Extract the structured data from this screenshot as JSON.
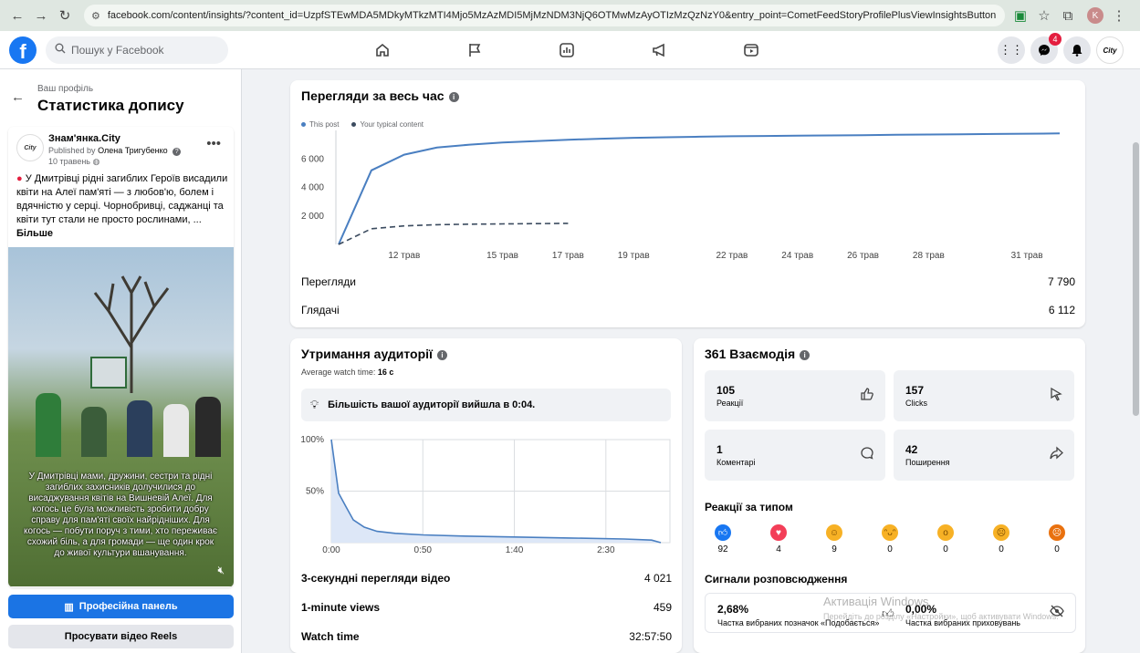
{
  "browser": {
    "url": "facebook.com/content/insights/?content_id=UzpfSTEwMDA5MDkyMTkzMTI4Mjo5MzAzMDI5MjMzNDM3NjQ6OTMwMzAyOTIzMzQzNzY0&entry_point=CometFeedStoryProfilePlusViewInsightsButton",
    "profile_initial": "K"
  },
  "fb": {
    "search_placeholder": "Пошук у Facebook",
    "messenger_badge": "4",
    "page_logo_text": "City"
  },
  "left": {
    "subtitle": "Ваш профіль",
    "title": "Статистика допису",
    "post": {
      "page_name": "Знам'янка.City",
      "published_prefix": "Published by",
      "author": "Олена Тригубенко",
      "date": "10 травень",
      "text": "У Дмитрівці рідні загиблих Героїв висадили квіти на Алеї пам'яті — з любов'ю, болем і вдячністю у серці. Чорнобривці, саджанці та квіти тут стали не просто рослинами, ...",
      "more": "Більше",
      "video_caption": "У Дмитрівці мами, дружини, сестри та рідні загиблих захисників долучилися до висаджування квітів на Вишневій Алеї. Для когось це була можливість зробити добру справу для пам'яті своїх найрідніших. Для когось — побути поруч з тими, хто переживає схожий біль, а для громади — ще один крок до живої культури вшанування.",
      "logo_text": "City"
    },
    "btn_pro": "Професійна панель",
    "btn_reels": "Просувати відео Reels"
  },
  "views": {
    "title": "Перегляди за весь час",
    "legend_this": "This post",
    "legend_typical": "Your typical content",
    "views_label": "Перегляди",
    "views_value": "7 790",
    "viewers_label": "Глядачі",
    "viewers_value": "6 112",
    "colors": {
      "this_post": "#4a7fc1",
      "typical": "#3b4b5f"
    }
  },
  "chart_data": [
    {
      "type": "line",
      "title": "Перегляди за весь час",
      "x": [
        "10 трав",
        "11 трав",
        "12 трав",
        "13 трав",
        "14 трав",
        "15 трав",
        "16 трав",
        "17 трав",
        "18 трав",
        "19 трав",
        "20 трав",
        "21 трав",
        "22 трав",
        "23 трав",
        "24 трав",
        "25 трав",
        "26 трав",
        "27 трав",
        "28 трав",
        "29 трав",
        "30 трав",
        "31 трав",
        "1 черв"
      ],
      "x_tick_labels": [
        "12 трав",
        "15 трав",
        "17 трав",
        "19 трав",
        "22 трав",
        "24 трав",
        "26 трав",
        "28 трав",
        "31 трав"
      ],
      "y_tick_labels": [
        "2 000",
        "4 000",
        "6 000"
      ],
      "ylim": [
        0,
        8000
      ],
      "series": [
        {
          "name": "This post",
          "values": [
            0,
            5200,
            6300,
            6800,
            7000,
            7150,
            7250,
            7350,
            7420,
            7480,
            7520,
            7560,
            7590,
            7610,
            7630,
            7650,
            7670,
            7690,
            7710,
            7730,
            7750,
            7770,
            7790
          ]
        },
        {
          "name": "Your typical content",
          "values": [
            0,
            1100,
            1300,
            1380,
            1420,
            1440,
            1460,
            1480
          ]
        }
      ]
    },
    {
      "type": "area",
      "title": "Утримання аудиторії",
      "x_tick_labels": [
        "0:00",
        "0:50",
        "1:40",
        "2:30"
      ],
      "y_tick_labels": [
        "100%",
        "50%"
      ],
      "xlim_seconds": [
        0,
        185
      ],
      "ylim": [
        0,
        100
      ],
      "x_seconds": [
        0,
        4,
        8,
        12,
        18,
        25,
        35,
        50,
        70,
        100,
        130,
        160,
        175,
        180
      ],
      "values": [
        100,
        48,
        35,
        22,
        15,
        11,
        9,
        7.5,
        6.5,
        5.5,
        4.5,
        3.5,
        2.5,
        0
      ]
    }
  ],
  "retention": {
    "title": "Утримання аудиторії",
    "avg_label": "Average watch time:",
    "avg_value": "16 с",
    "note": "Більшість вашої аудиторії вийшла в 0:04.",
    "rows": [
      {
        "label": "3-секундні перегляди відео",
        "value": "4 021"
      },
      {
        "label": "1-minute views",
        "value": "459"
      },
      {
        "label": "Watch time",
        "value": "32:57:50"
      }
    ]
  },
  "interactions": {
    "title": "361 Взаємодія",
    "metrics": [
      {
        "value": "105",
        "label": "Реакції",
        "icon": "like-icon"
      },
      {
        "value": "157",
        "label": "Clicks",
        "icon": "cursor-icon"
      },
      {
        "value": "1",
        "label": "Коментарі",
        "icon": "comment-icon"
      },
      {
        "value": "42",
        "label": "Поширення",
        "icon": "share-icon"
      }
    ],
    "reactions_title": "Реакції за типом",
    "reactions": [
      {
        "name": "like",
        "count": "92",
        "color": "#1877f2"
      },
      {
        "name": "love",
        "count": "4",
        "color": "#f33e58"
      },
      {
        "name": "care",
        "count": "9",
        "color": "#f7b125"
      },
      {
        "name": "haha",
        "count": "0",
        "color": "#f7b125"
      },
      {
        "name": "wow",
        "count": "0",
        "color": "#f7b125"
      },
      {
        "name": "sad",
        "count": "0",
        "color": "#f7b125"
      },
      {
        "name": "angry",
        "count": "0",
        "color": "#e9710f"
      }
    ],
    "signals_title": "Сигнали розповсюдження",
    "signal1_value": "2,68%",
    "signal1_label": "Частка вибраних позначок «Подобається»",
    "signal2_value": "0,00%",
    "signal2_label": "Частка вибраних приховувань"
  },
  "watermark": {
    "line1": "Активація Windows",
    "line2": "Перейдіть до розділу «Настройки», щоб активувати Windows."
  }
}
